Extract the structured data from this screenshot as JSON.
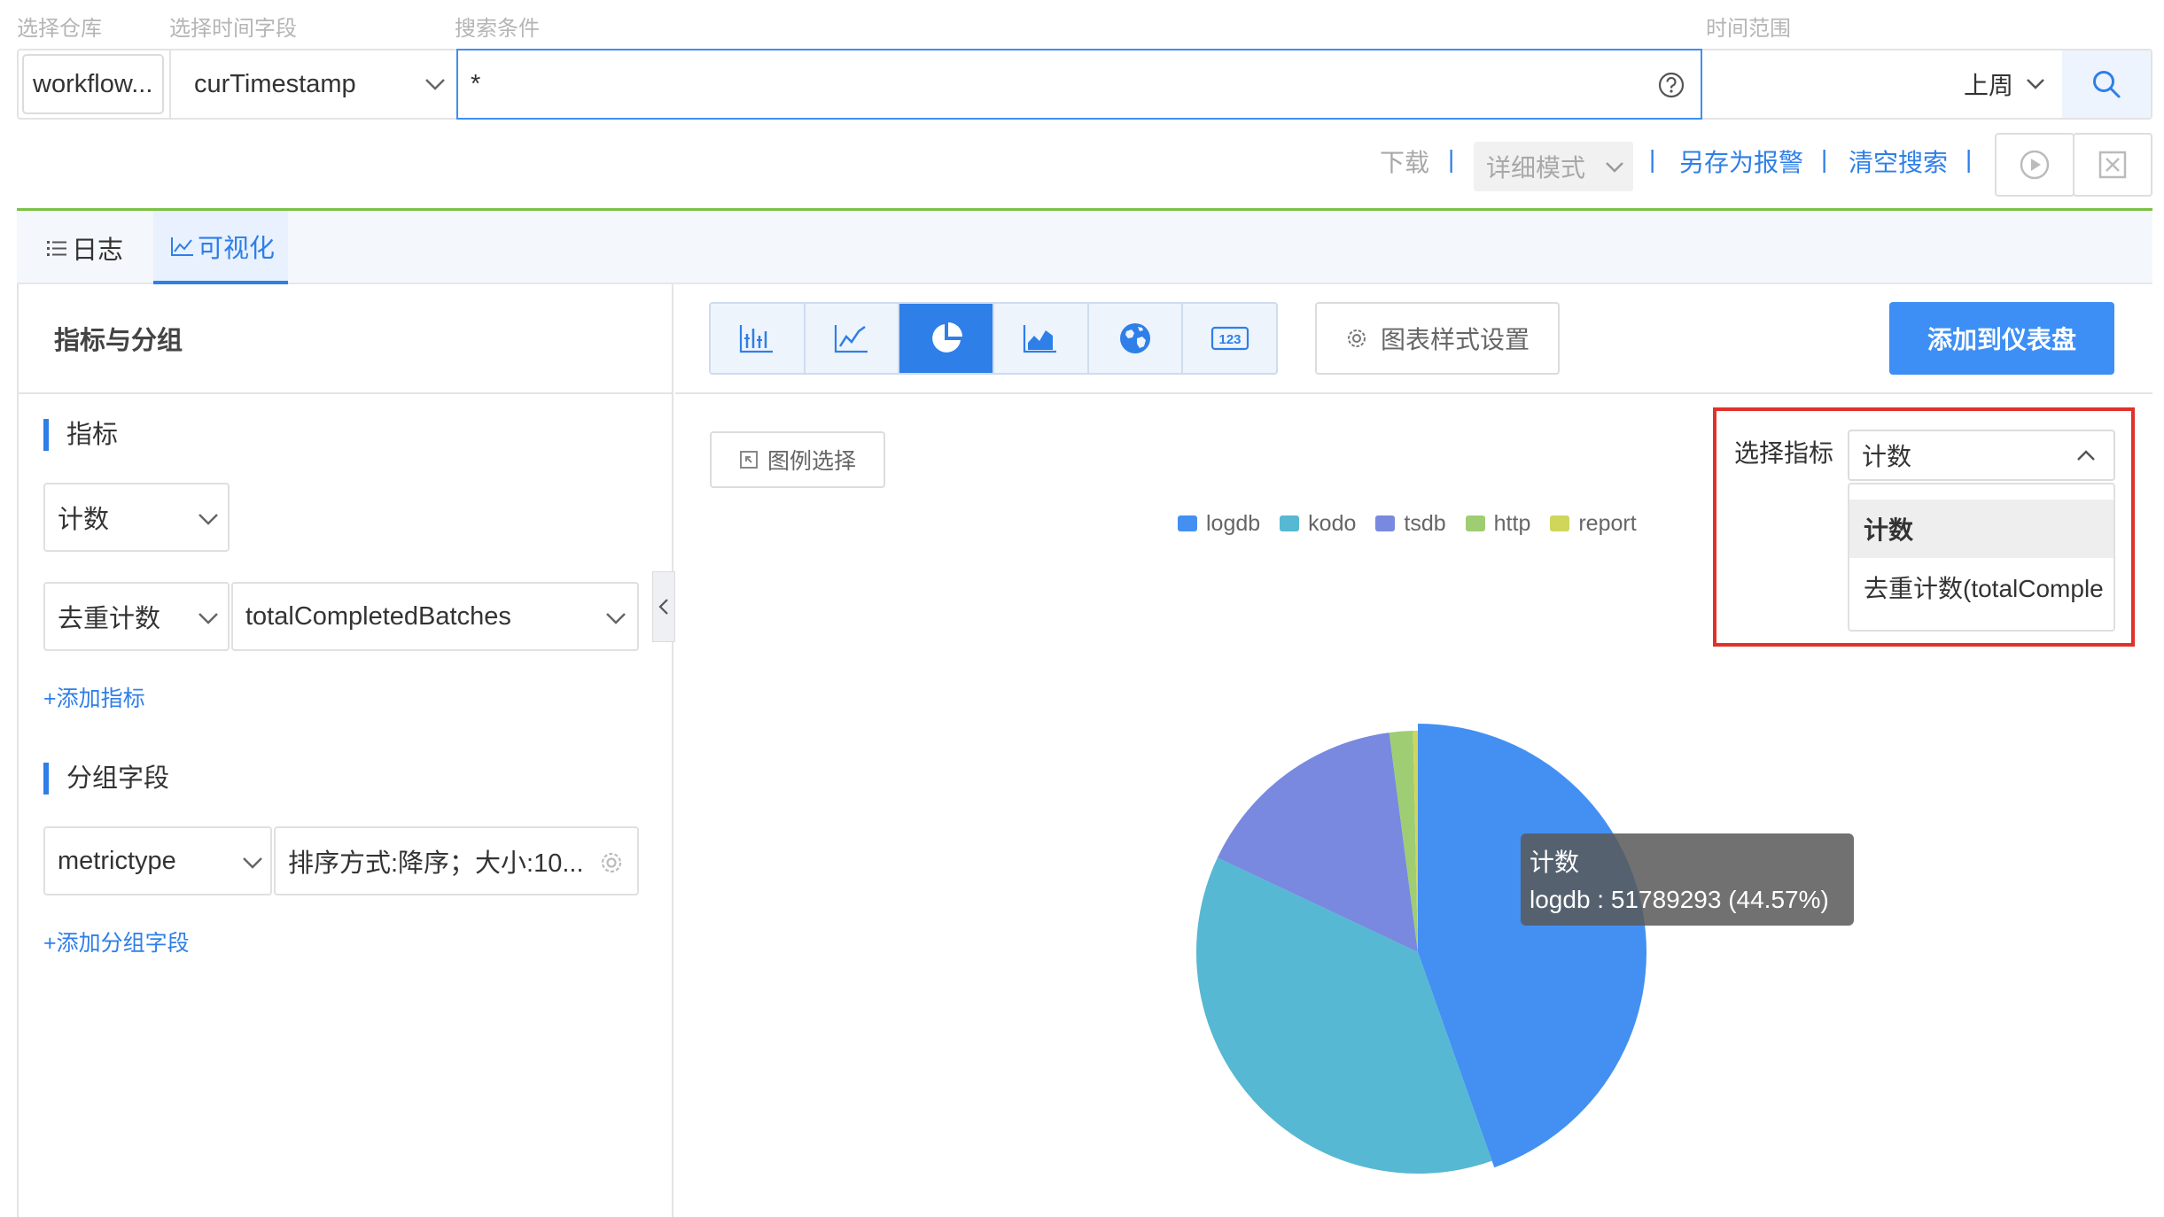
{
  "labels": {
    "repo": "选择仓库",
    "time_field": "选择时间字段",
    "search": "搜索条件",
    "time_range": "时间范围"
  },
  "query": {
    "repo_value": "workflow...",
    "time_field_value": "curTimestamp",
    "search_value": "*",
    "time_range_value": "上周"
  },
  "actions": {
    "download": "下载",
    "mode": "详细模式",
    "save_alert": "另存为报警",
    "clear": "清空搜索",
    "sep": "|"
  },
  "tabs": [
    {
      "label": "日志",
      "icon": "list-icon"
    },
    {
      "label": "可视化",
      "icon": "line-chart-icon"
    }
  ],
  "left": {
    "header": "指标与分组",
    "metrics_title": "指标",
    "metric1": "计数",
    "metric2_agg": "去重计数",
    "metric2_field": "totalCompletedBatches",
    "add_metric": "+添加指标",
    "group_title": "分组字段",
    "group_field": "metrictype",
    "group_sort": "排序方式:降序；大小:10...",
    "add_group": "+添加分组字段"
  },
  "toolbar": {
    "style_settings": "图表样式设置",
    "add_dashboard": "添加到仪表盘",
    "legend_select": "图例选择",
    "chart_types": [
      "bar-chart-icon",
      "line-chart-icon",
      "pie-chart-icon",
      "area-chart-icon",
      "globe-icon",
      "number-icon"
    ],
    "active_type": "pie-chart-icon"
  },
  "metric_selector": {
    "label": "选择指标",
    "value": "计数",
    "options": [
      "计数",
      "去重计数(totalComple"
    ]
  },
  "tooltip": {
    "title": "计数",
    "line": "logdb : 51789293 (44.57%)"
  },
  "colors": {
    "accent": "#2e7fe8",
    "logdb": "#4390f2",
    "kodo": "#56b8d2",
    "tsdb": "#7889df",
    "http": "#9fcd73",
    "report": "#cfd65a"
  },
  "chart_data": {
    "type": "pie",
    "series_name": "计数",
    "categories": [
      "logdb",
      "kodo",
      "tsdb",
      "http",
      "report"
    ],
    "values": [
      51789293,
      43500000,
      18500000,
      2000000,
      400000
    ],
    "percent_shown": {
      "logdb": 44.57
    }
  }
}
